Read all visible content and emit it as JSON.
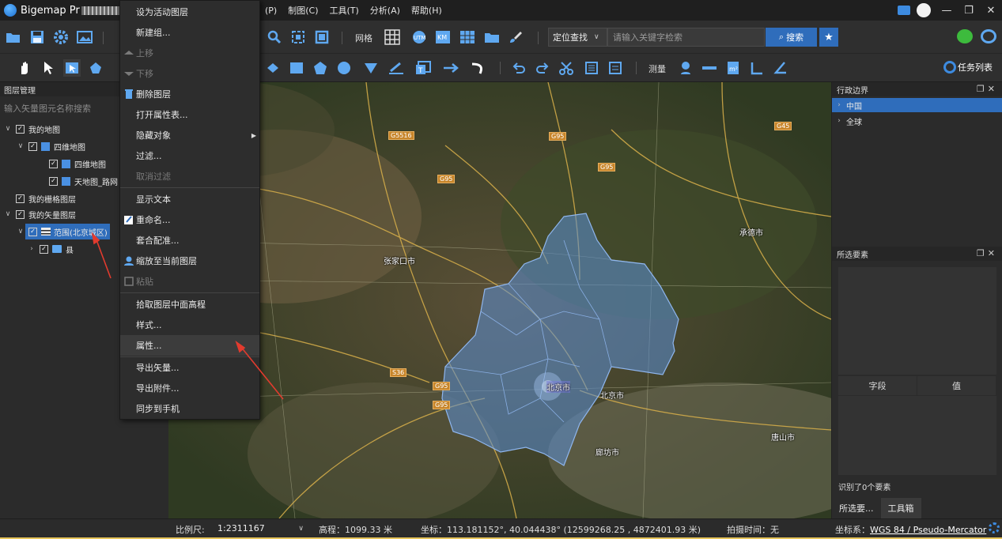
{
  "titlebar": {
    "app_title": "Bigemap Pr",
    "menus": [
      "(P)",
      "制图(C)",
      "工具(T)",
      "分析(A)",
      "帮助(H)"
    ]
  },
  "window_controls": {
    "minimize": "—",
    "restore": "❐",
    "close": "✕"
  },
  "toolbar1": {
    "grid_label": "网格",
    "search_mode": "定位查找",
    "search_placeholder": "请输入关键字检索",
    "search_button": "搜索"
  },
  "toolbar2": {
    "measure_label": "测量",
    "task_list_label": "任务列表"
  },
  "left_panel": {
    "title": "图层管理",
    "search_placeholder": "输入矢量图元名称搜索",
    "tree": [
      {
        "label": "我的地图",
        "expander": "∨",
        "checked": "✓"
      },
      {
        "label": "四维地图",
        "expander": "∨",
        "checked": "✓"
      },
      {
        "label": "四维地图",
        "expander": "",
        "checked": "✓"
      },
      {
        "label": "天地图_路网",
        "expander": "",
        "checked": "✓"
      },
      {
        "label": "我的栅格图层",
        "expander": "",
        "checked": "✓"
      },
      {
        "label": "我的矢量图层",
        "expander": "∨",
        "checked": "✓"
      },
      {
        "label": "范围(北京城区)",
        "expander": "∨",
        "checked": "✓"
      },
      {
        "label": "县",
        "expander": "›",
        "checked": "✓"
      }
    ]
  },
  "context_menu": {
    "items": [
      {
        "label": "设为活动图层",
        "disabled": false
      },
      {
        "label": "新建组...",
        "disabled": false
      },
      {
        "label": "上移",
        "disabled": true
      },
      {
        "label": "下移",
        "disabled": true
      },
      {
        "label": "删除图层",
        "disabled": false
      },
      {
        "label": "打开属性表...",
        "disabled": false
      },
      {
        "label": "隐藏对象",
        "disabled": false,
        "submenu": "▶"
      },
      {
        "label": "过滤...",
        "disabled": false
      },
      {
        "label": "取消过滤",
        "disabled": true
      },
      {
        "label": "显示文本",
        "disabled": false
      },
      {
        "label": "重命名...",
        "disabled": false
      },
      {
        "label": "套合配准...",
        "disabled": false
      },
      {
        "label": "缩放至当前图层",
        "disabled": false
      },
      {
        "label": "粘贴",
        "disabled": true
      },
      {
        "label": "拾取图层中面高程",
        "disabled": false
      },
      {
        "label": "样式...",
        "disabled": false
      },
      {
        "label": "属性...",
        "disabled": false,
        "hover": true
      },
      {
        "label": "导出矢量...",
        "disabled": false
      },
      {
        "label": "导出附件...",
        "disabled": false
      },
      {
        "label": "同步到手机",
        "disabled": false
      }
    ]
  },
  "map": {
    "cities": [
      "张家口市",
      "承德市",
      "北京市",
      "唐山市",
      "廊坊市",
      "北京市"
    ],
    "roads": [
      "G5516",
      "G95",
      "G95",
      "G95",
      "S36",
      "G95",
      "G95",
      "G45"
    ]
  },
  "right_panel": {
    "admin_title": "行政边界",
    "admin_items": [
      {
        "label": "中国",
        "expander": "›"
      },
      {
        "label": "全球",
        "expander": "›"
      }
    ],
    "selected_title": "所选要素",
    "header_buttons": "❐✕",
    "table_headers": [
      "字段",
      "值"
    ],
    "identify_status": "识别了0个要素",
    "tabs": [
      "所选要...",
      "工具箱"
    ]
  },
  "statusbar": {
    "scale_label": "比例尺:",
    "scale_value": "1:2311167",
    "elevation": "高程：1099.33 米",
    "coordinates": "坐标：113.181152°, 40.044438°  (12599268.25 , 4872401.93 米)",
    "capture_time": "拍摄时间：无",
    "crs_label": "坐标系：",
    "crs_value": "WGS 84 / Pseudo-Mercator"
  },
  "colors": {
    "accent": "#2f6dbb",
    "polygon": "#5b8fd6",
    "annotation_arrow": "#e23b2e"
  }
}
